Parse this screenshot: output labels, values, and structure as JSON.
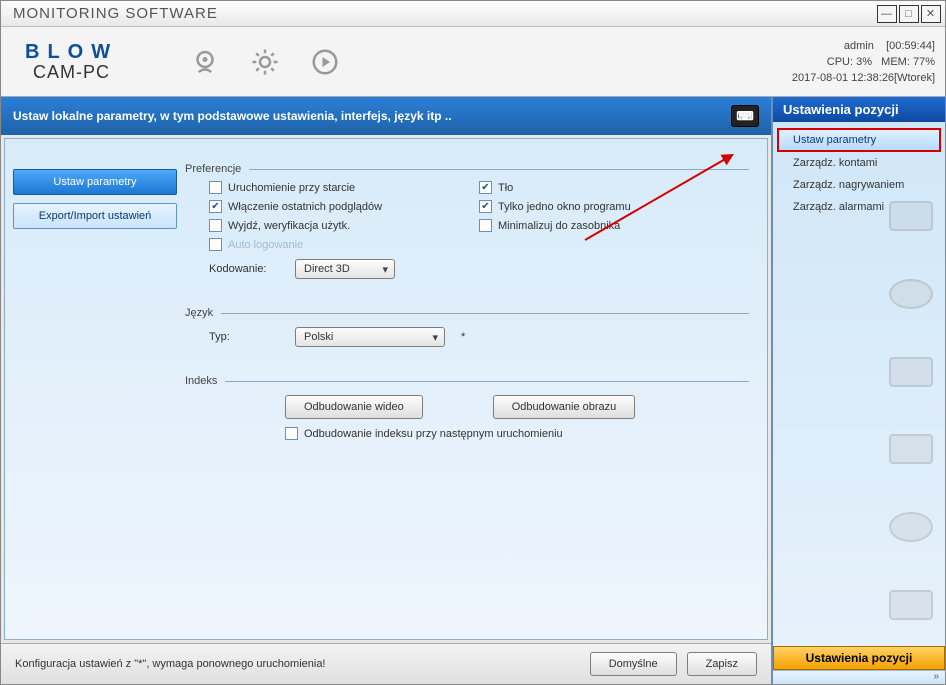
{
  "titlebar": {
    "title": "MONITORING SOFTWARE"
  },
  "header": {
    "logo": "BLOW",
    "logo_sub": "CAM-PC",
    "info_user": "admin",
    "info_uptime": "[00:59:44]",
    "info_cpu_label": "CPU:",
    "info_cpu": "3%",
    "info_mem_label": "MEM:",
    "info_mem": "77%",
    "info_datetime": "2017-08-01 12:38:26[Wtorek]"
  },
  "subheader": {
    "text": "Ustaw lokalne parametry, w tym podstawowe ustawienia, interfejs, język itp .."
  },
  "left_tabs": {
    "set_params": "Ustaw parametry",
    "export_import": "Export/Import ustawień"
  },
  "prefs": {
    "section": "Preferencje",
    "startup": "Uruchomienie przy starcie",
    "bg": "Tło",
    "last_previews": "Włączenie ostatnich podglądów",
    "one_window": "Tylko jedno okno programu",
    "exit_verify": "Wyjdź, weryfikacja użytk.",
    "minimize_tray": "Minimalizuj do zasobnika",
    "auto_login": "Auto logowanie",
    "encoding_label": "Kodowanie:",
    "encoding_value": "Direct 3D"
  },
  "lang": {
    "section": "Język",
    "type_label": "Typ:",
    "type_value": "Polski"
  },
  "index": {
    "section": "Indeks",
    "rebuild_video": "Odbudowanie wideo",
    "rebuild_image": "Odbudowanie obrazu",
    "rebuild_next": "Odbudowanie indeksu przy następnym uruchomieniu"
  },
  "bottom": {
    "note": "Konfiguracja ustawień z \"*\", wymaga ponownego uruchomienia!",
    "defaults": "Domyślne",
    "save": "Zapisz"
  },
  "right": {
    "header": "Ustawienia pozycji",
    "item_params": "Ustaw parametry",
    "item_accounts": "Zarządz. kontami",
    "item_recording": "Zarządz. nagrywaniem",
    "item_alarms": "Zarządz. alarmami",
    "bottom": "Ustawienia pozycji",
    "expand": "»"
  }
}
